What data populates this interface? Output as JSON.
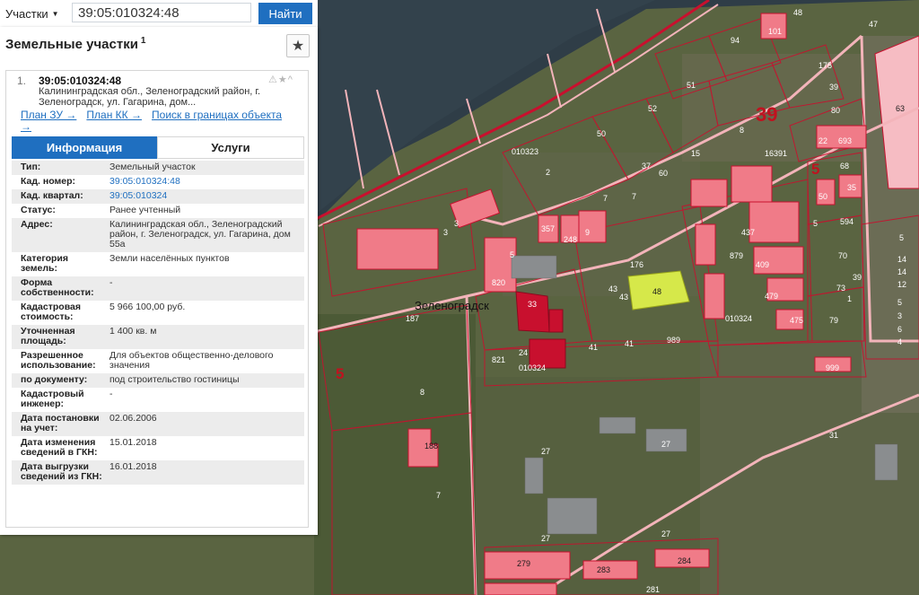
{
  "search": {
    "layer_label": "Участки",
    "query": "39:05:010324:48",
    "button_label": "Найти"
  },
  "panel": {
    "title": "Земельные участки",
    "count": "1"
  },
  "result": {
    "index": "1.",
    "cadastral_number": "39:05:010324:48",
    "address_short": "Калининградская обл., Зеленоградский район, г. Зеленоградск, ул. Гагарина, дом...",
    "links": [
      "План ЗУ →",
      "План КК →",
      "Поиск в границах объекта →"
    ],
    "status_icons": "⚠★^"
  },
  "tabs": [
    "Информация",
    "Услуги"
  ],
  "info": [
    {
      "key": "Тип:",
      "value": "Земельный участок"
    },
    {
      "key": "Кад. номер:",
      "value": "39:05:010324:48"
    },
    {
      "key": "Кад. квартал:",
      "value": "39:05:010324"
    },
    {
      "key": "Статус:",
      "value": "Ранее учтенный"
    },
    {
      "key": "Адрес:",
      "value": "Калининградская обл., Зеленоградский район, г. Зеленоградск, ул. Гагарина, дом 55а"
    },
    {
      "key": "Категория земель:",
      "value": "Земли населённых пунктов"
    },
    {
      "key": "Форма собственности:",
      "value": "-"
    },
    {
      "key": "Кадастровая стоимость:",
      "value": "5 966 100,00 руб."
    },
    {
      "key": "Уточненная площадь:",
      "value": "1 400 кв. м"
    },
    {
      "key": "Разрешенное использование:",
      "value": "Для объектов общественно-делового значения"
    },
    {
      "key": "по документу:",
      "value": "под строительство гостиницы"
    },
    {
      "key": "Кадастровый инженер:",
      "value": "-"
    },
    {
      "key": "Дата постановки на учет:",
      "value": "02.06.2006"
    },
    {
      "key": "Дата изменения сведений в ГКН:",
      "value": "15.01.2018"
    },
    {
      "key": "Дата выгрузки сведений из ГКН:",
      "value": "16.01.2018"
    }
  ],
  "map": {
    "city_label": "Зеленоградск",
    "region_labels": [
      "39",
      "5",
      "5"
    ],
    "quarter_labels": [
      "010323",
      "010324",
      "010324"
    ],
    "parcel_labels": [
      "48",
      "47",
      "101",
      "94",
      "175",
      "63",
      "51",
      "52",
      "50",
      "39",
      "80",
      "22",
      "693",
      "8",
      "15",
      "16391",
      "2",
      "37",
      "60",
      "68",
      "50",
      "35",
      "7",
      "7",
      "5",
      "594",
      "70",
      "39",
      "73",
      "1",
      "79",
      "3",
      "3",
      "5",
      "357",
      "248",
      "9",
      "176",
      "48",
      "43",
      "43",
      "879",
      "437",
      "409",
      "479",
      "475",
      "010324",
      "820",
      "33",
      "24",
      "821",
      "187",
      "8",
      "41",
      "41",
      "989",
      "999",
      "188",
      "7",
      "27",
      "27",
      "31",
      "27",
      "27",
      "279",
      "283",
      "284",
      "281",
      "5",
      "14",
      "14",
      "12",
      "6",
      "5",
      "3",
      "4"
    ],
    "colors": {
      "parcel_outline": "#c8102e",
      "parcel_fill": "#f07b88",
      "selected_fill": "#d6e84a",
      "water": "#2d3b45",
      "road": "#f3b4ba"
    }
  }
}
